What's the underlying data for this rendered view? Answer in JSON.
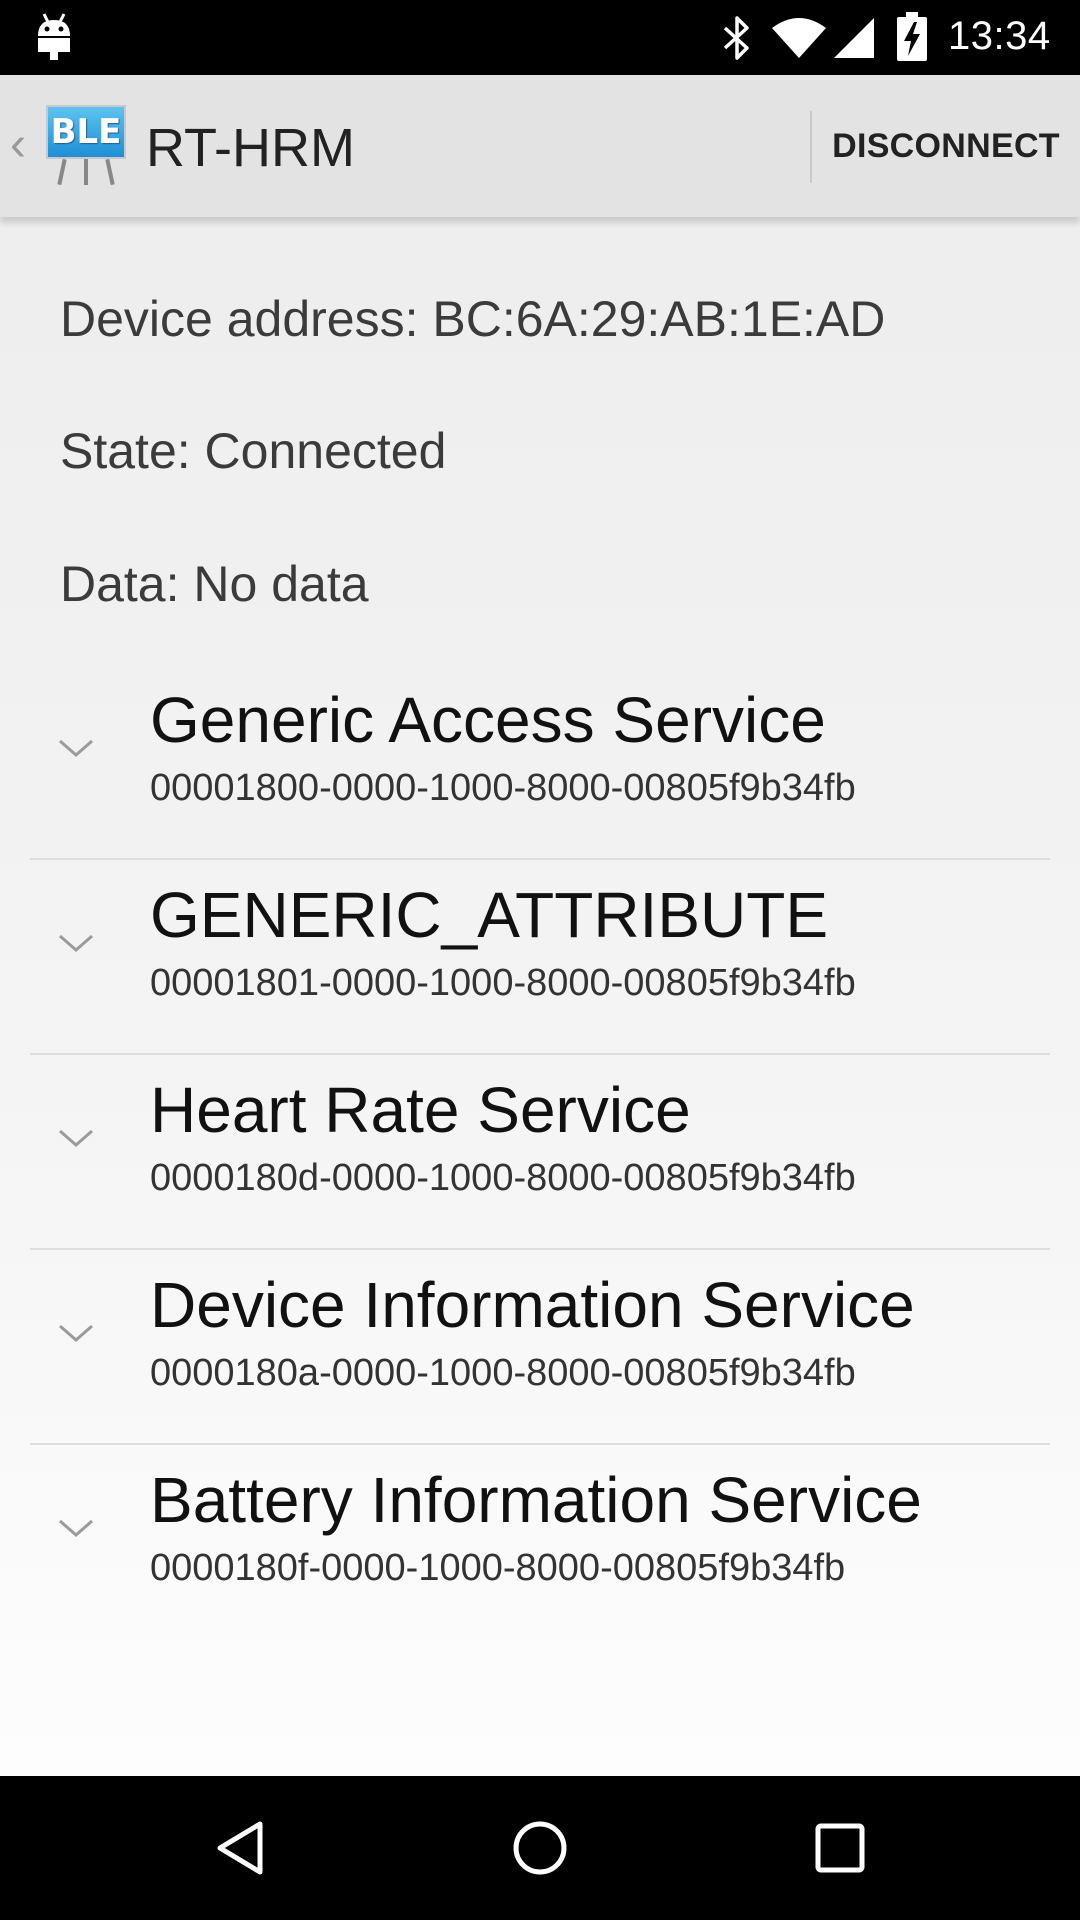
{
  "status_bar": {
    "time": "13:34",
    "icons": [
      "android-icon",
      "bluetooth-icon",
      "wifi-icon",
      "cell-signal-icon",
      "battery-charging-icon"
    ]
  },
  "action_bar": {
    "logo_text": "BLE",
    "title": "RT-HRM",
    "disconnect_label": "DISCONNECT"
  },
  "info": {
    "device_address": "Device address: BC:6A:29:AB:1E:AD",
    "state": "State: Connected",
    "data": "Data: No data"
  },
  "services": [
    {
      "name": "Generic Access Service",
      "uuid": "00001800-0000-1000-8000-00805f9b34fb"
    },
    {
      "name": "GENERIC_ATTRIBUTE",
      "uuid": "00001801-0000-1000-8000-00805f9b34fb"
    },
    {
      "name": "Heart Rate Service",
      "uuid": "0000180d-0000-1000-8000-00805f9b34fb"
    },
    {
      "name": "Device Information Service",
      "uuid": "0000180a-0000-1000-8000-00805f9b34fb"
    },
    {
      "name": "Battery Information Service",
      "uuid": "0000180f-0000-1000-8000-00805f9b34fb"
    }
  ],
  "nav_bar": {
    "icons": [
      "back-icon",
      "home-icon",
      "recents-icon"
    ]
  },
  "colors": {
    "status_bar_bg": "#000000",
    "action_bar_bg": "#e3e3e3",
    "logo_blue": "#1d8fd6",
    "nav_bar_bg": "#000000"
  }
}
